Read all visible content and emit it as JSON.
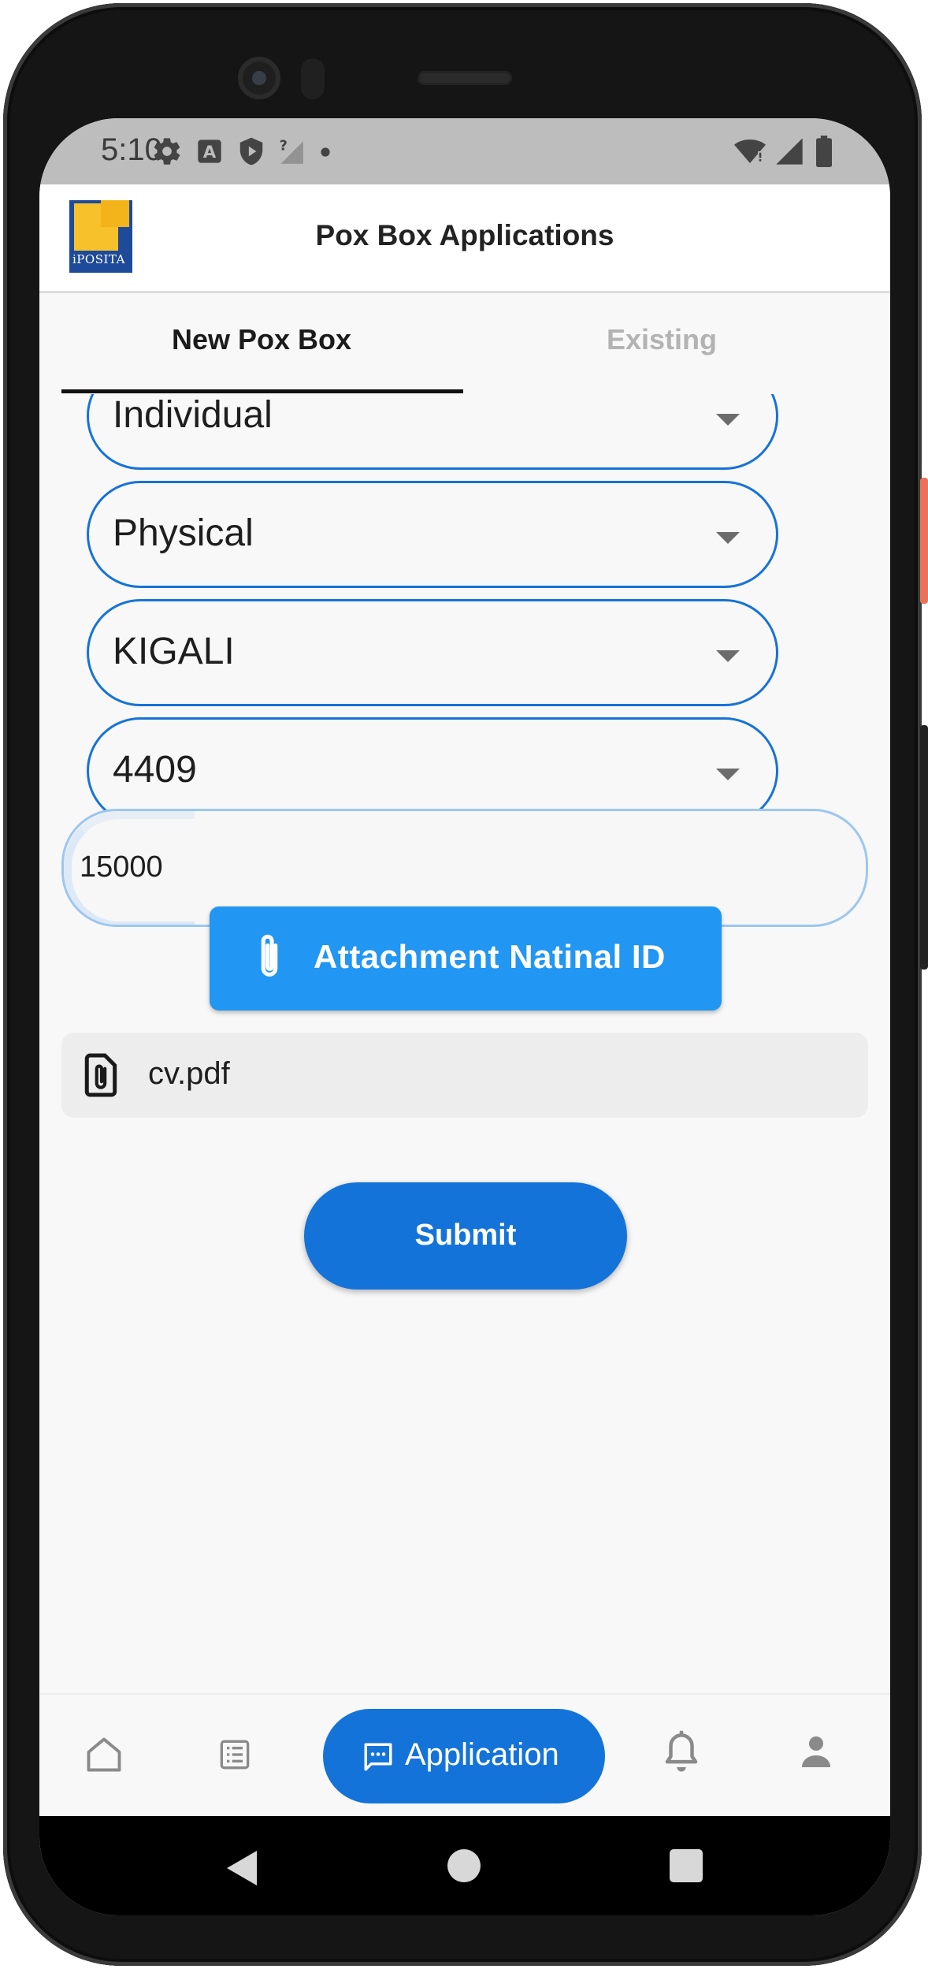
{
  "status_bar": {
    "time": "5:10",
    "left_icons": [
      "settings-icon",
      "a-notification-icon",
      "shield-icon",
      "no-signal-icon",
      "dot-icon"
    ],
    "right_icons": [
      "wifi-icon",
      "cell-signal-icon",
      "battery-icon"
    ]
  },
  "app_bar": {
    "title": "Pox Box Applications",
    "logo_text": "iPOSITA"
  },
  "tabs": [
    {
      "label": "New Pox Box",
      "active": true
    },
    {
      "label": "Existing",
      "active": false
    }
  ],
  "form": {
    "applicant_type": "Individual",
    "box_type": "Physical",
    "location": "KIGALI",
    "box_number": "4409",
    "amount": "15000",
    "attach_button": "Attachment Natinal ID",
    "attached_file": "cv.pdf",
    "submit_button": "Submit"
  },
  "bottom_nav": {
    "items": [
      {
        "icon": "home-icon",
        "active": false
      },
      {
        "icon": "list-icon",
        "active": false
      },
      {
        "icon": "chat-icon",
        "label": "Application",
        "active": true
      },
      {
        "icon": "bell-icon",
        "active": false
      },
      {
        "icon": "person-icon",
        "active": false
      }
    ]
  },
  "colors": {
    "primary": "#1473d9",
    "attach_button": "#2196f3",
    "field_border": "#1773d6",
    "status_bar": "#bdbdbd"
  }
}
